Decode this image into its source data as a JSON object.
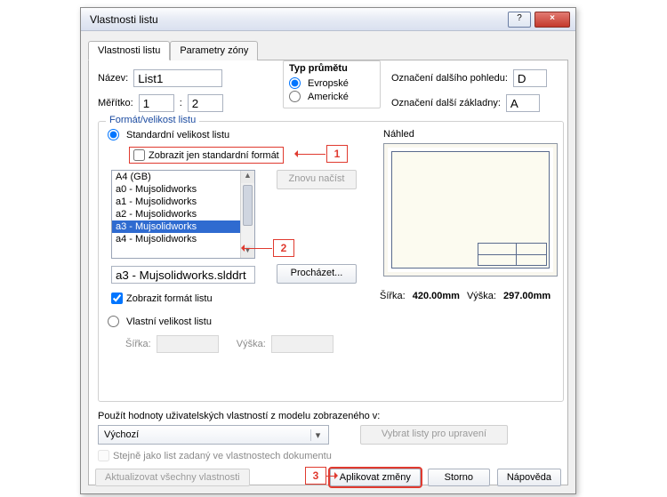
{
  "window": {
    "title": "Vlastnosti listu",
    "help_btn": "?",
    "close_btn": "×"
  },
  "tabs": {
    "t1": "Vlastnosti listu",
    "t2": "Parametry zóny"
  },
  "name_label": "Název:",
  "name_value": "List1",
  "scale_label": "Měřítko:",
  "scale_a": "1",
  "scale_sep": ":",
  "scale_b": "2",
  "projection": {
    "group": "Typ průmětu",
    "european": "Evropské",
    "american": "Americké"
  },
  "nextview_label": "Označení dalšího pohledu:",
  "nextview_value": "D",
  "nextdatum_label": "Označení další základny:",
  "nextdatum_value": "A",
  "format_group": "Formát/velikost listu",
  "std_radio": "Standardní velikost listu",
  "only_std": "Zobrazit jen standardní formát",
  "reload_btn": "Znovu načíst",
  "sheet_list": {
    "i0": "A4 (GB)",
    "i1": "a0 - Mujsolidworks",
    "i2": "a1 - Mujsolidworks",
    "i3": "a2 - Mujsolidworks",
    "i4": "a3 - Mujsolidworks",
    "i5": "a4 - Mujsolidworks"
  },
  "sheet_path": "a3 - Mujsolidworks.slddrt",
  "browse_btn": "Procházet...",
  "show_format": "Zobrazit formát listu",
  "custom_radio": "Vlastní velikost listu",
  "width_label": "Šířka:",
  "height_label": "Výška:",
  "preview_title": "Náhled",
  "dims": {
    "wl": "Šířka:",
    "wv": "420.00mm",
    "hl": "Výška:",
    "hv": "297.00mm"
  },
  "usevals_label": "Použít hodnoty uživatelských vlastností z modelu zobrazeného v:",
  "usevals_combo": "Výchozí",
  "select_sheets_btn": "Vybrat listy pro upravení",
  "same_as_doc": "Stejně jako list zadaný ve vlastnostech dokumentu",
  "update_all_btn": "Aktualizovat všechny vlastnosti",
  "apply_btn": "Aplikovat změny",
  "cancel_btn": "Storno",
  "help_btn": "Nápověda",
  "callouts": {
    "c1": "1",
    "c2": "2",
    "c3": "3"
  }
}
